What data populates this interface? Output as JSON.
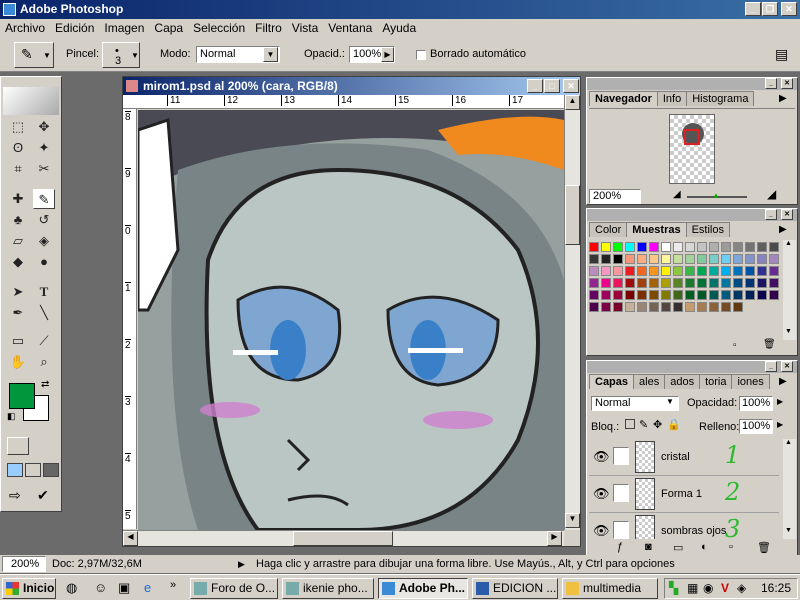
{
  "app": {
    "title": "Adobe Photoshop"
  },
  "menu": [
    "Archivo",
    "Edición",
    "Imagen",
    "Capa",
    "Selección",
    "Filtro",
    "Vista",
    "Ventana",
    "Ayuda"
  ],
  "options": {
    "brush_label": "Pincel:",
    "brush_size": "3",
    "mode_label": "Modo:",
    "mode_value": "Normal",
    "opacity_label": "Opacid.:",
    "opacity_value": "100%",
    "auto_erase_label": "Borrado automático"
  },
  "document": {
    "title": "mirom1.psd al 200% (cara, RGB/8)",
    "ruler_top": [
      "11",
      "12",
      "13",
      "14",
      "15",
      "16",
      "17"
    ],
    "ruler_left": [
      "8",
      "9",
      "0",
      "1",
      "2",
      "3",
      "4",
      "5"
    ]
  },
  "navigator": {
    "tabs": [
      "Navegador",
      "Info",
      "Histograma"
    ],
    "zoom": "200%"
  },
  "swatches": {
    "tabs": [
      "Color",
      "Muestras",
      "Estilos"
    ]
  },
  "layers_panel": {
    "tabs": [
      "Capas",
      "ales",
      "ados",
      "toria",
      "iones"
    ],
    "blend_mode": "Normal",
    "opacity_label": "Opacidad:",
    "opacity_value": "100%",
    "lock_label": "Bloq.:",
    "fill_label": "Relleno:",
    "fill_value": "100%",
    "layers": [
      {
        "name": "cristal",
        "annotation": "1"
      },
      {
        "name": "Forma 1",
        "annotation": "2"
      },
      {
        "name": "sombras ojos",
        "annotation": "3"
      }
    ]
  },
  "status": {
    "zoom": "200%",
    "doc": "Doc: 2,97M/32,6M",
    "hint": "Haga clic y arrastre para dibujar una forma libre. Use Mayús., Alt, y Ctrl para opciones adicionales."
  },
  "taskbar": {
    "start": "Inicio",
    "tasks": [
      "Foro de O...",
      "ikenie pho...",
      "Adobe Ph...",
      "EDICION ...",
      "multimedia"
    ],
    "clock": "16:25"
  },
  "colors": {
    "foreground": "#00963c",
    "background": "#ffffff",
    "title_blue": "#0a246a"
  }
}
